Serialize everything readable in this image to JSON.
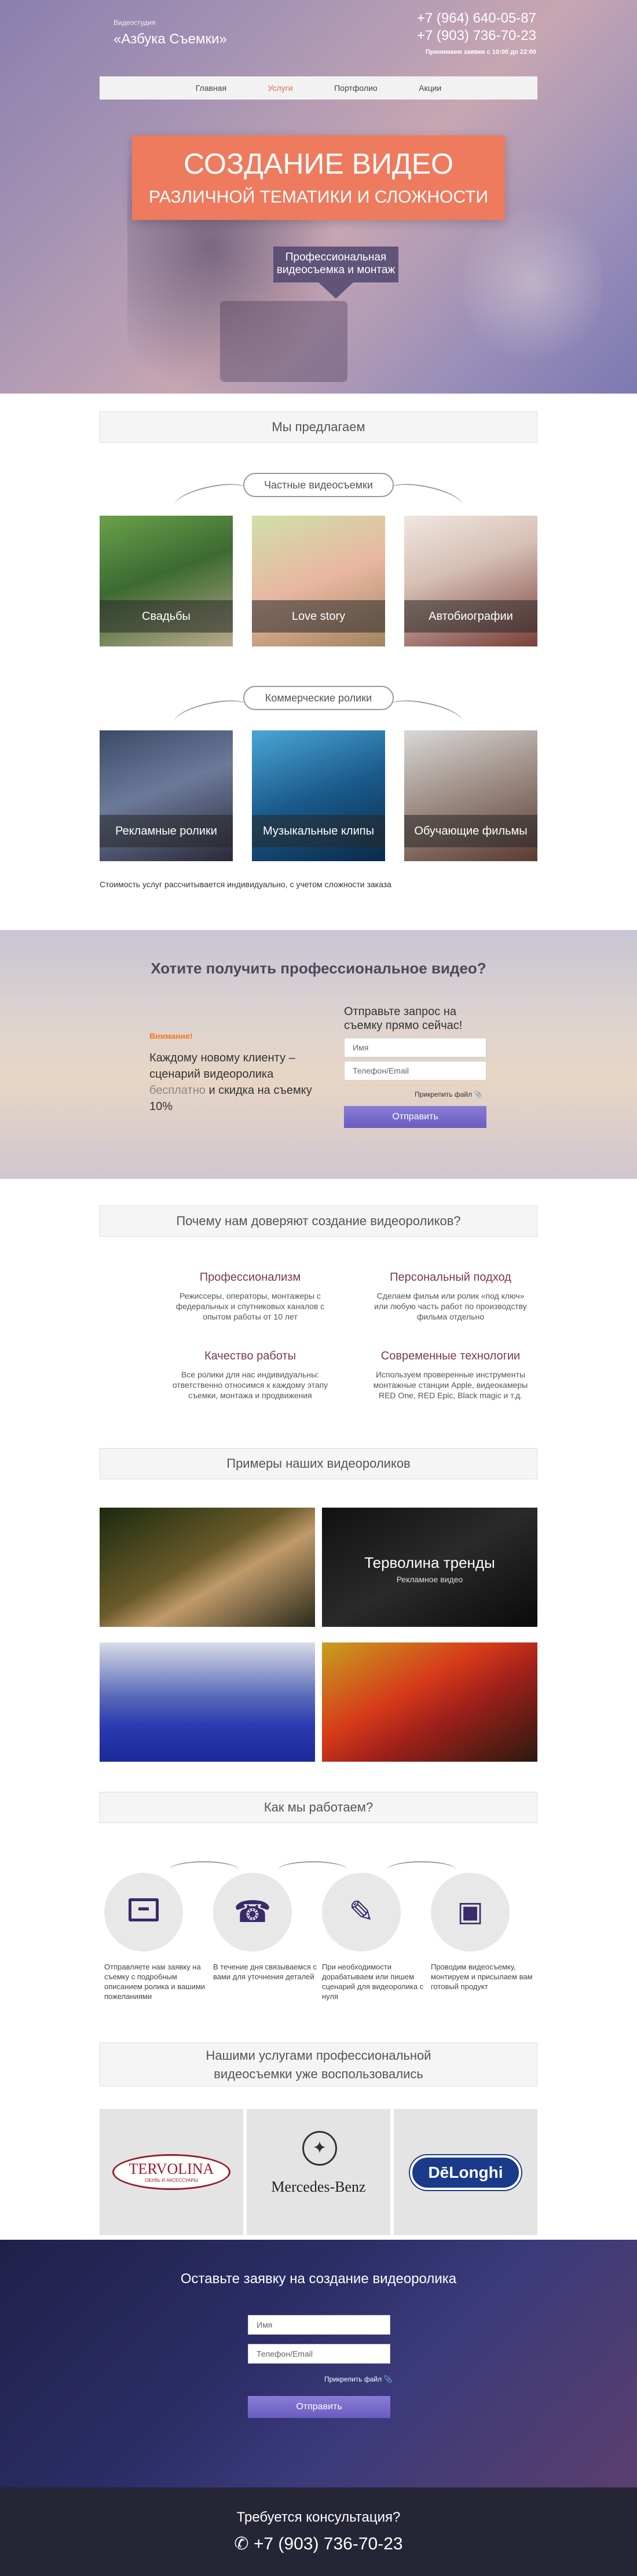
{
  "header": {
    "studio_label": "Видеостудия",
    "studio_name": "«Азбука Съемки»",
    "phone1": "+7 (964) 640-05-87",
    "phone2": "+7 (903) 736-70-23",
    "hours": "Принимаем заявки с 10:00 до 22:00"
  },
  "nav": [
    "Главная",
    "Услуги",
    "Портфолио",
    "Акции"
  ],
  "hero": {
    "title": "СОЗДАНИЕ ВИДЕО",
    "subtitle": "РАЗЛИЧНОЙ ТЕМАТИКИ И СЛОЖНОСТИ",
    "badge": "Профессиональная видеосъемка и монтаж"
  },
  "offers": {
    "title": "Мы предлагаем",
    "private_label": "Частные видеосъемки",
    "private": [
      "Свадьбы",
      "Love story",
      "Автобиографии"
    ],
    "commercial_label": "Коммерческие ролики",
    "commercial": [
      "Рекламные ролики",
      "Музыкальные клипы",
      "Обучающие фильмы"
    ],
    "note": "Стоимость услуг рассчитывается индивидуально, с учетом сложности заказа"
  },
  "cta": {
    "title": "Хотите получить профессиональное видео?",
    "warning": "Внимание!",
    "offer_a": "Каждому новому клиенту – сценарий видеоролика",
    "offer_hl": "бесплатно",
    "offer_b": "и скидка на съемку 10%",
    "form_title": "Отправьте запрос на съемку прямо сейчас!",
    "name_placeholder": "Имя",
    "contact_placeholder": "Телефон/Email",
    "attach": "Прикрепить файл",
    "submit": "Отправить"
  },
  "trust": {
    "title": "Почему нам доверяют создание видеороликов?",
    "items": [
      {
        "title": "Профессионализм",
        "text": "Режиссеры, операторы, монтажеры с федеральных и спутниковых каналов с опытом работы от 10 лет"
      },
      {
        "title": "Персональный подход",
        "text": "Сделаем фильм или ролик «под ключ» или любую часть работ по производству фильма отдельно"
      },
      {
        "title": "Качество работы",
        "text": "Все ролики для нас индивидуальны: ответственно относимся к каждому этапу съемки, монтажа и продвижения"
      },
      {
        "title": "Современные технологии",
        "text": "Используем проверенные инструменты монтажные станции Apple, видеокамеры RED One, RED Epic, Black magic и т.д."
      }
    ]
  },
  "examples": {
    "title": "Примеры наших видеороликов",
    "featured_title": "Терволина тренды",
    "featured_sub": "Рекламное видео"
  },
  "how": {
    "title": "Как мы работаем?",
    "steps": [
      "Отправляете нам заявку на съемку с подробным описанием ролика и вашими пожеланиями",
      "В течение дня связываемся с вами для уточнения деталей",
      "При необходимости дорабатываем или пишем сценарий для видеоролика с нуля",
      "Проводим видеосъемку, монтируем и присылаем вам готовый продукт"
    ]
  },
  "clients": {
    "title": "Нашими услугами профессиональной видеосъемки уже воспользовались",
    "logos": [
      "TERVOLINA",
      "ОБУВЬ И АКСЕССУАРЫ",
      "Mercedes-Benz",
      "DēLonghi"
    ]
  },
  "bottom_form": {
    "title": "Оставьте заявку на создание видеоролика",
    "name_placeholder": "Имя",
    "contact_placeholder": "Телефон/Email",
    "attach": "Прикрепить файл",
    "submit": "Отправить"
  },
  "footer": {
    "title": "Требуется консультация?",
    "phone": "+7 (903) 736-70-23"
  },
  "colors": {
    "accent": "#ee7b5e",
    "button": "#7a6cd0",
    "feature_title": "#7a3c4a",
    "footer": "#252535"
  }
}
